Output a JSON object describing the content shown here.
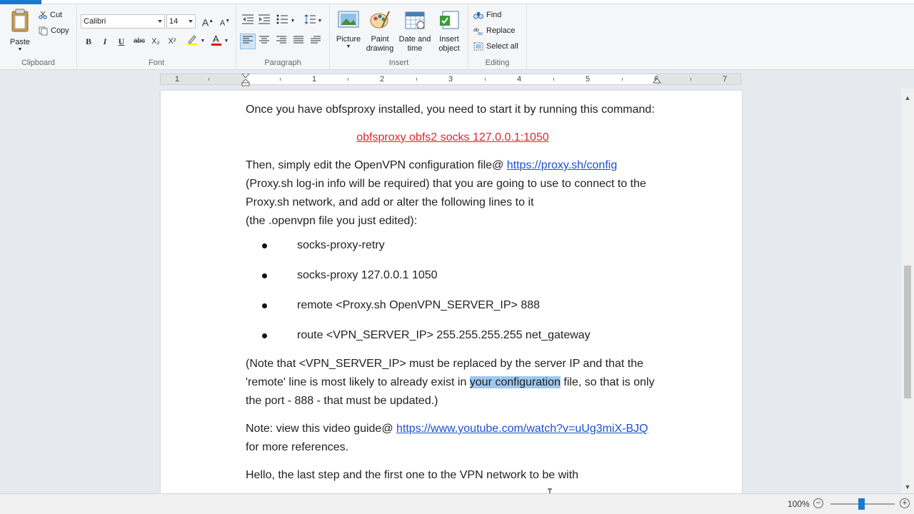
{
  "ribbon": {
    "clipboard": {
      "label": "Clipboard",
      "paste": "Paste",
      "cut": "Cut",
      "copy": "Copy"
    },
    "font": {
      "label": "Font",
      "family": "Calibri",
      "size": "14",
      "bold": "B",
      "italic": "I",
      "underline": "U",
      "strike": "abc",
      "subscript": "X₂",
      "superscript": "X²"
    },
    "paragraph": {
      "label": "Paragraph"
    },
    "insert": {
      "label": "Insert",
      "picture": "Picture",
      "paint1": "Paint",
      "paint2": "drawing",
      "date1": "Date and",
      "date2": "time",
      "obj1": "Insert",
      "obj2": "object"
    },
    "editing": {
      "label": "Editing",
      "find": "Find",
      "replace": "Replace",
      "select_all": "Select all"
    }
  },
  "ruler": {
    "numbers": [
      "1",
      "1",
      "2",
      "3",
      "4",
      "5",
      "6",
      "7"
    ]
  },
  "document": {
    "p1": "Once you have obfsproxy installed, you need to start it by running this command:",
    "command": "obfsproxy obfs2 socks 127.0.0.1:1050",
    "p2_before": "Then, simply edit the OpenVPN configuration file@ ",
    "p2_link": "https://proxy.sh/config",
    "p2_after": " (Proxy.sh log-in info will be required) that you are going to use to connect to the Proxy.sh network, and add or alter the following lines to it",
    "p2_tail": "(the .openvpn file you just edited):",
    "bullets": [
      "socks-proxy-retry",
      "socks-proxy 127.0.0.1 1050",
      "remote <Proxy.sh OpenVPN_SERVER_IP> 888",
      "route <VPN_SERVER_IP> 255.255.255.255 net_gateway"
    ],
    "p3_before": "(Note that <VPN_SERVER_IP> must be replaced by the server IP and that the 'remote' line is most likely to already exist in ",
    "p3_selected": "your configuration",
    "p3_after": " file, so that is only the port - 888 - that must be updated.)",
    "p4_before": "Note: view this video guide@ ",
    "p4_link": "https://www.youtube.com/watch?v=uUg3miX-BJQ",
    "p4_after": " for more references.",
    "p5_partial": "Hello, the last step and the first one to the VPN network to be with"
  },
  "status": {
    "zoom": "100%",
    "zoom_level_percent": 100
  },
  "colors": {
    "accent": "#1979ca",
    "selection": "#9ec8f0",
    "link": "#1a4fd6",
    "command": "#e0262b"
  }
}
